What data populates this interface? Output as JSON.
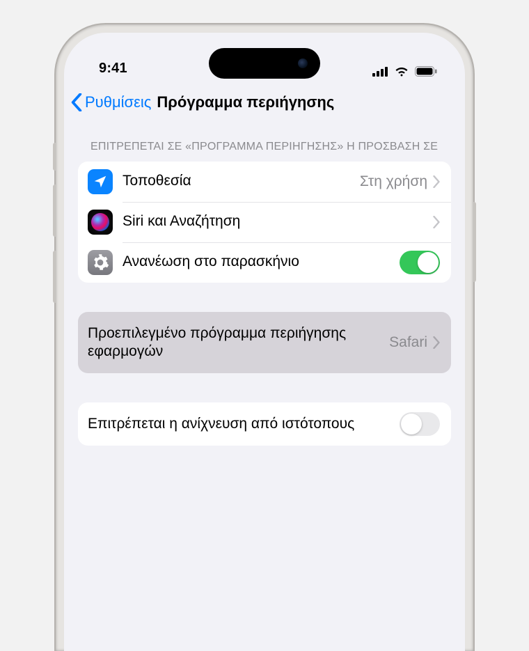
{
  "status": {
    "time": "9:41"
  },
  "nav": {
    "back_label": "Ρυθμίσεις",
    "title": "Πρόγραμμα περιήγησης"
  },
  "section1": {
    "header": "ΕΠΙΤΡΕΠΕΤΑΙ ΣΕ «ΠΡΟΓΡΑΜΜΑ ΠΕΡΙΗΓΗΣΗΣ» Η ΠΡΟΣΒΑΣΗ ΣΕ",
    "location": {
      "label": "Τοποθεσία",
      "value": "Στη χρήση"
    },
    "siri": {
      "label": "Siri και Αναζήτηση"
    },
    "refresh": {
      "label": "Ανανέωση στο παρασκήνιο",
      "on": true
    }
  },
  "section2": {
    "default_browser": {
      "label": "Προεπιλεγμένο πρόγραμμα περιήγησης εφαρμογών",
      "value": "Safari"
    }
  },
  "section3": {
    "tracking": {
      "label": "Επιτρέπεται η ανίχνευση από ιστότοπους",
      "on": false
    }
  },
  "colors": {
    "accent_blue": "#007aff",
    "switch_green": "#34c759"
  }
}
